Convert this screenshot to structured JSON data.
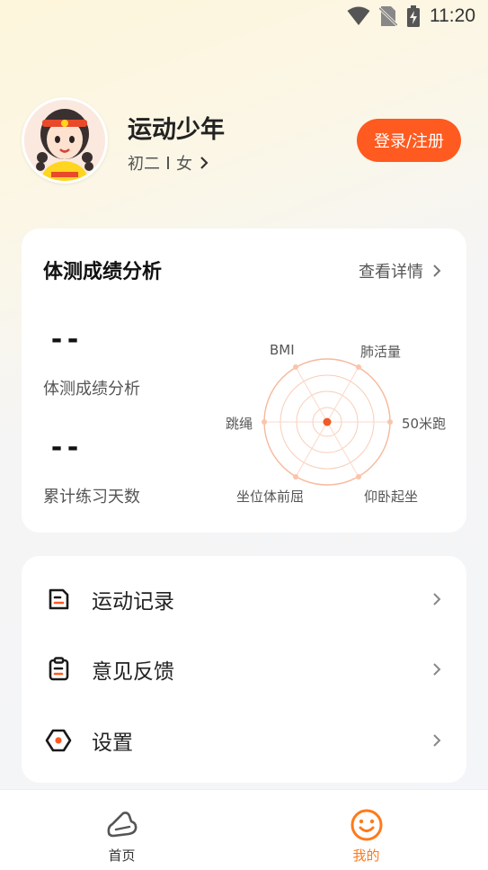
{
  "status_bar": {
    "time": "11:20",
    "icons": [
      "wifi-icon",
      "no-sim-icon",
      "battery-charging-icon"
    ]
  },
  "profile": {
    "name": "运动少年",
    "grade": "初二",
    "gender": "女",
    "login_label": "登录/注册"
  },
  "analysis": {
    "title": "体测成绩分析",
    "details_label": "查看详情",
    "stats": [
      {
        "value": "--",
        "label": "体测成绩分析"
      },
      {
        "value": "--",
        "label": "累计练习天数"
      }
    ],
    "radar_axes": [
      "BMI",
      "肺活量",
      "50米跑",
      "仰卧起坐",
      "坐位体前屈",
      "跳绳"
    ]
  },
  "menu": {
    "items": [
      {
        "label": "运动记录",
        "icon": "record-icon"
      },
      {
        "label": "意见反馈",
        "icon": "feedback-icon"
      },
      {
        "label": "设置",
        "icon": "settings-icon"
      }
    ]
  },
  "tabs": [
    {
      "label": "首页",
      "icon": "shoe-icon",
      "active": false
    },
    {
      "label": "我的",
      "icon": "smile-icon",
      "active": true
    }
  ],
  "colors": {
    "accent": "#ff5a1f",
    "active_tab": "#ff7a1a",
    "radar": "#f7b89b"
  }
}
